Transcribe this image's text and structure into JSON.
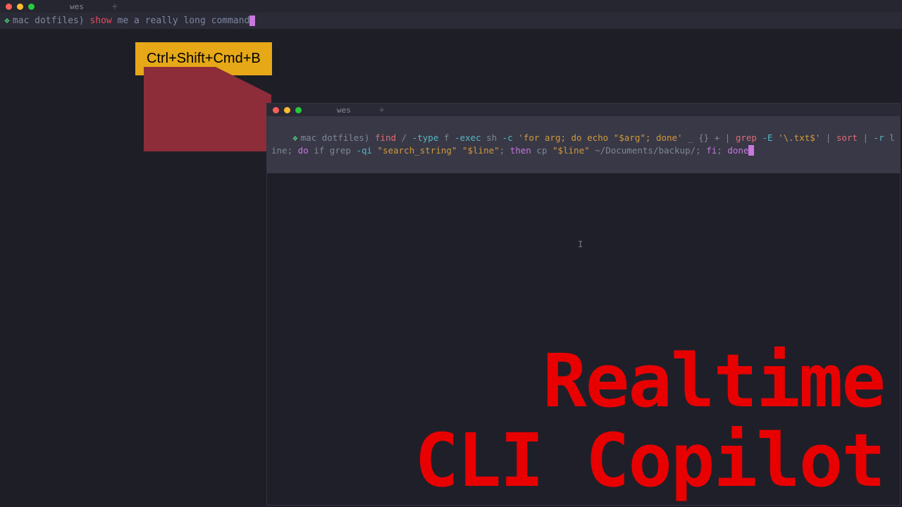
{
  "outer": {
    "tab_title": "wes",
    "prompt": {
      "host": "mac",
      "dir": "dotfiles",
      "cmd_head": "show",
      "cmd_rest": " me a really long command"
    }
  },
  "shortcut": {
    "label": "Ctrl+Shift+Cmd+B"
  },
  "inner": {
    "tab_title": "wes",
    "prompt": {
      "host": "mac",
      "dir": "dotfiles"
    },
    "command_tokens": [
      {
        "t": "find",
        "c": "cmd-red2"
      },
      {
        "t": " / ",
        "c": "cmd-gray"
      },
      {
        "t": "-type",
        "c": "cmd-cyan"
      },
      {
        "t": " f ",
        "c": "cmd-gray"
      },
      {
        "t": "-exec",
        "c": "cmd-cyan"
      },
      {
        "t": " sh ",
        "c": "cmd-gray"
      },
      {
        "t": "-c",
        "c": "cmd-cyan"
      },
      {
        "t": " 'for arg; do echo \"$arg\"; done'",
        "c": "cmd-yellow"
      },
      {
        "t": " _ {} + | ",
        "c": "cmd-gray"
      },
      {
        "t": "grep",
        "c": "cmd-red2"
      },
      {
        "t": " ",
        "c": "cmd-gray"
      },
      {
        "t": "-E",
        "c": "cmd-cyan"
      },
      {
        "t": " '\\.txt$'",
        "c": "cmd-yellow"
      },
      {
        "t": " | ",
        "c": "cmd-gray"
      },
      {
        "t": "sort",
        "c": "cmd-red2"
      },
      {
        "t": " | ",
        "c": "cmd-gray"
      },
      {
        "t": "-r",
        "c": "cmd-cyan"
      },
      {
        "t": " line; ",
        "c": "cmd-gray"
      },
      {
        "t": "do",
        "c": "cmd-mag"
      },
      {
        "t": " if grep ",
        "c": "cmd-gray"
      },
      {
        "t": "-qi",
        "c": "cmd-cyan"
      },
      {
        "t": " \"search_string\"",
        "c": "cmd-yellow"
      },
      {
        "t": " \"$line\"",
        "c": "cmd-yellow"
      },
      {
        "t": "; ",
        "c": "cmd-gray"
      },
      {
        "t": "then",
        "c": "cmd-mag"
      },
      {
        "t": " cp ",
        "c": "cmd-gray"
      },
      {
        "t": "\"$line\"",
        "c": "cmd-yellow"
      },
      {
        "t": " ~/Documents/backup/; ",
        "c": "cmd-gray"
      },
      {
        "t": "fi",
        "c": "cmd-mag"
      },
      {
        "t": "; ",
        "c": "cmd-gray"
      },
      {
        "t": "done",
        "c": "cmd-mag"
      }
    ]
  },
  "title": {
    "line1": "Realtime",
    "line2": "CLI Copilot"
  },
  "colors": {
    "bg": "#1e1e26",
    "accent_red": "#e80000",
    "yellow_box": "#e6a817",
    "arrow": "#8e2d3a"
  }
}
